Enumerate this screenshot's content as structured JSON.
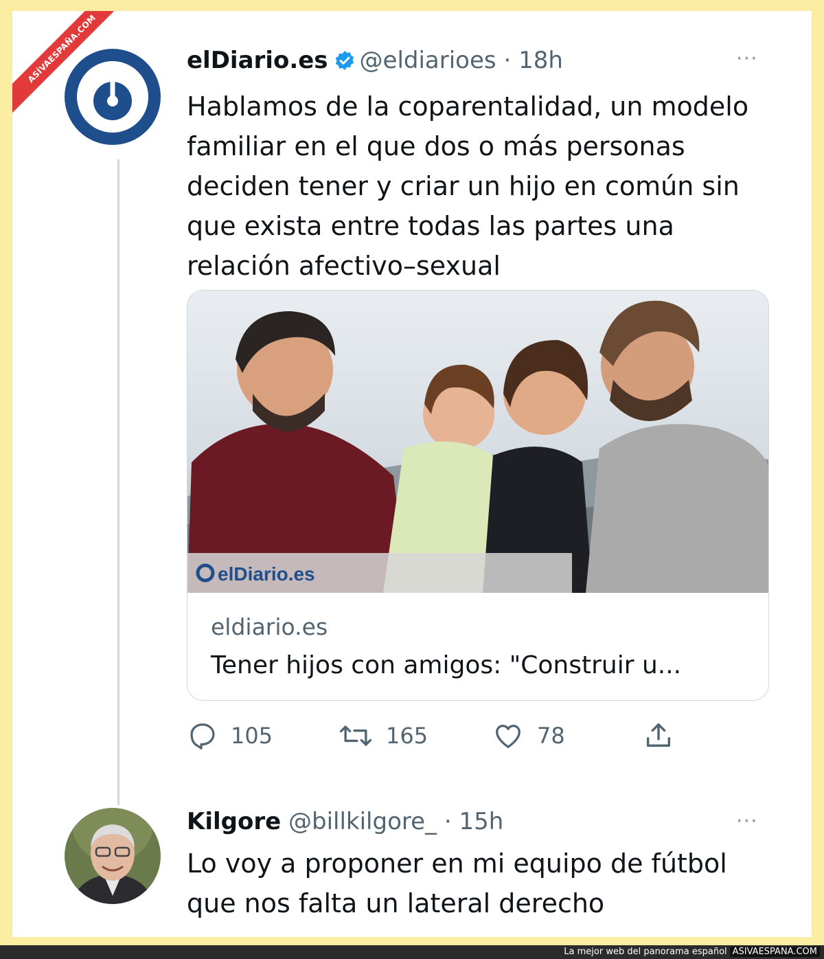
{
  "watermark": {
    "ribbon": "ASÍVAESPAÑA.COM"
  },
  "tweet": {
    "author_name": "elDiario.es",
    "handle": "@eldiarioes",
    "separator": "·",
    "time": "18h",
    "more": "···",
    "verified_icon": "verified-badge-icon",
    "text": "Hablamos de la coparentalidad, un modelo familiar en el que dos o más personas deciden tener y criar un hijo en común sin que exista entre todas las partes una relación afectivo–sexual",
    "card": {
      "photo_watermark": "elDiario.es",
      "domain": "eldiario.es",
      "title": "Tener hijos con amigos: \"Construir u..."
    },
    "actions": {
      "replies": "105",
      "retweets": "165",
      "likes": "78"
    }
  },
  "reply": {
    "author_name": "Kilgore",
    "handle": "@billkilgore_",
    "separator": "·",
    "time": "15h",
    "more": "···",
    "text": "Lo voy a proponer en mi equipo de fútbol que nos falta un lateral derecho"
  },
  "footer": {
    "tagline": "La mejor web del panorama español",
    "brand": "ASIVAESPANA.COM"
  },
  "colors": {
    "background": "#fbeea3",
    "ribbon": "#e23a3a",
    "brand_blue": "#1f4e8c",
    "verified": "#1d9bf0",
    "muted": "#536471"
  }
}
